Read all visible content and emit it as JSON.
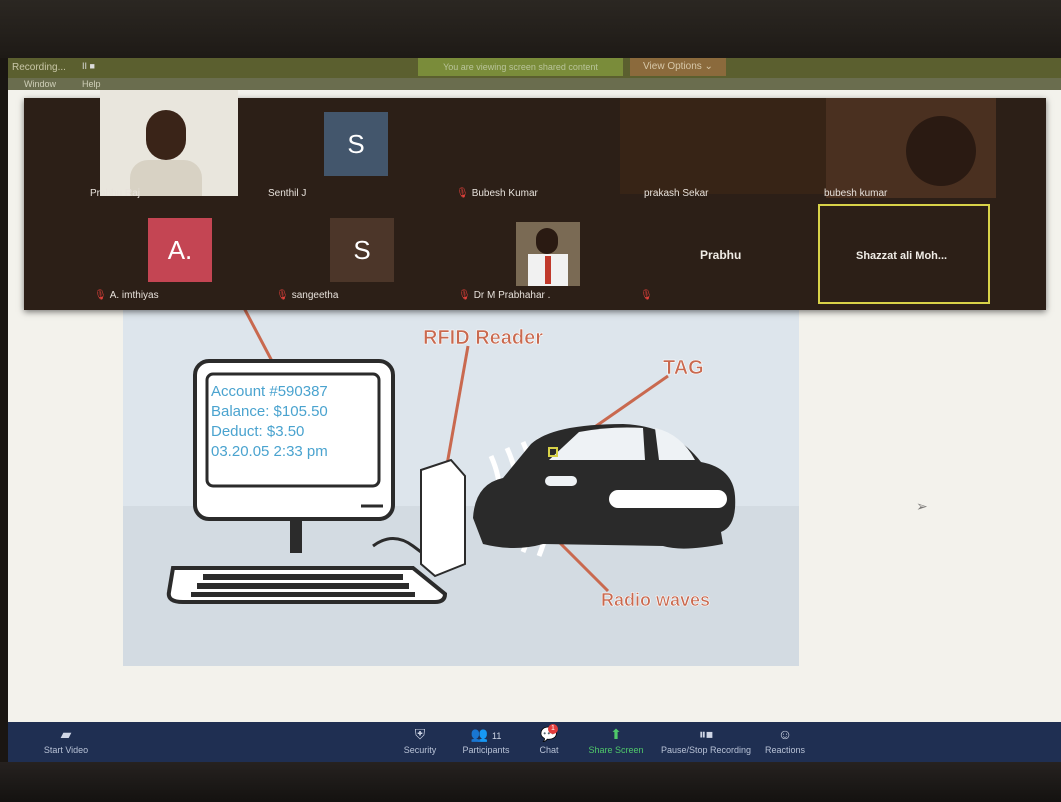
{
  "recording_bar": {
    "label": "Recording...",
    "pause_controls": "II ■",
    "notice": "You are viewing screen shared content",
    "view_options": "View Options ⌄"
  },
  "menu": [
    "Window",
    "Help"
  ],
  "participants": [
    {
      "name": "Prabhu Raj",
      "type": "video",
      "muted": false
    },
    {
      "name": "Senthil J",
      "type": "avatar",
      "initial": "S",
      "color": "#43566c",
      "muted": false
    },
    {
      "name": "Bubesh Kumar",
      "type": "none",
      "muted": true
    },
    {
      "name": "prakash Sekar",
      "type": "video",
      "muted": false
    },
    {
      "name": "bubesh kumar",
      "type": "video",
      "muted": false
    },
    {
      "name": "A. imthiyas",
      "type": "avatar",
      "initial": "A.",
      "color": "#c44553",
      "muted": true
    },
    {
      "name": "sangeetha",
      "type": "avatar",
      "initial": "S",
      "color": "#4c3629",
      "muted": true
    },
    {
      "name": "Dr M Prabhahar .",
      "type": "photo",
      "muted": true
    },
    {
      "name": "Prabhu",
      "type": "name-only",
      "muted": true
    },
    {
      "name": "Shazzat ali Moh...",
      "type": "name-only",
      "muted": false,
      "active_speaker": true
    }
  ],
  "slide": {
    "screen_lines": [
      "Account #590387",
      "Balance: $105.50",
      "Deduct: $3.50",
      "03.20.05 2:33 pm"
    ],
    "label_reader": "RFID Reader",
    "label_tag": "TAG",
    "label_waves": "Radio waves"
  },
  "toolbar": {
    "start_video": "Start Video",
    "security": "Security",
    "participants": "Participants",
    "participant_count": "11",
    "chat": "Chat",
    "chat_badge": "1",
    "share_screen": "Share Screen",
    "pause_recording": "Pause/Stop Recording",
    "reactions": "Reactions"
  },
  "colors": {
    "toolbar_bg": "#1f2f52",
    "share_green": "#4fc86a",
    "active_speaker_border": "#d8d248",
    "slide_label": "#c9694f",
    "slide_text": "#4aa3cf"
  }
}
